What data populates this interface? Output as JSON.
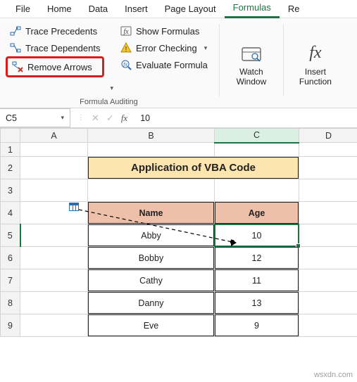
{
  "tabs": {
    "file": "File",
    "home": "Home",
    "data": "Data",
    "insert": "Insert",
    "page_layout": "Page Layout",
    "formulas": "Formulas",
    "review": "Re"
  },
  "ribbon": {
    "trace_precedents": "Trace Precedents",
    "trace_dependents": "Trace Dependents",
    "remove_arrows": "Remove Arrows",
    "show_formulas": "Show Formulas",
    "error_checking": "Error Checking",
    "evaluate_formula": "Evaluate Formula",
    "watch_window_l1": "Watch",
    "watch_window_l2": "Window",
    "insert_function_l1": "Insert",
    "insert_function_l2": "Function",
    "group_label": "Formula Auditing"
  },
  "formula_bar": {
    "name_box": "C5",
    "value": "10"
  },
  "columns": [
    "A",
    "B",
    "C",
    "D"
  ],
  "rows": [
    "1",
    "2",
    "3",
    "4",
    "5",
    "6",
    "7",
    "8",
    "9"
  ],
  "sheet": {
    "title": "Application of VBA Code",
    "headers": {
      "name": "Name",
      "age": "Age"
    },
    "data": [
      {
        "name": "Abby",
        "age": "10"
      },
      {
        "name": "Bobby",
        "age": "12"
      },
      {
        "name": "Cathy",
        "age": "11"
      },
      {
        "name": "Danny",
        "age": "13"
      },
      {
        "name": "Eve",
        "age": "9"
      }
    ]
  },
  "watermark": "wsxdn.com"
}
